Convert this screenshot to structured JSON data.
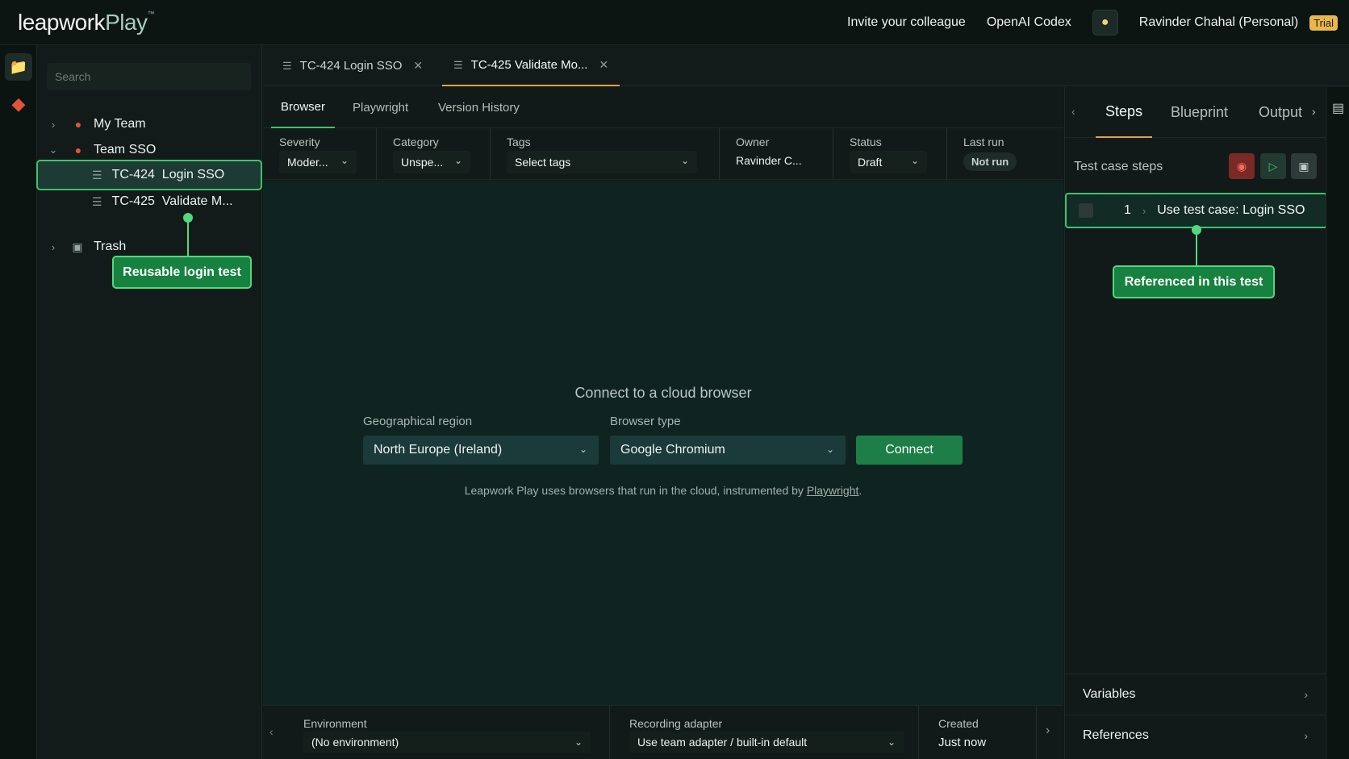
{
  "app": {
    "logo_main": "leapwork",
    "logo_accent": "Play",
    "logo_tm": "™"
  },
  "topbar": {
    "invite": "Invite your colleague",
    "openai": "OpenAI Codex",
    "user": "Ravinder Chahal (Personal)",
    "trial": "Trial"
  },
  "sidebar": {
    "search_placeholder": "Search",
    "items": [
      {
        "label": "My Team"
      },
      {
        "label": "Team SSO"
      },
      {
        "label": "TC-424  Login SSO"
      },
      {
        "label": "TC-425  Validate M..."
      },
      {
        "label": "Trash"
      }
    ]
  },
  "tabs": [
    {
      "label": "TC-424 Login SSO"
    },
    {
      "label": "TC-425 Validate Mo..."
    }
  ],
  "subtabs": [
    "Browser",
    "Playwright",
    "Version History"
  ],
  "meta": {
    "severity_label": "Severity",
    "severity_value": "Moder...",
    "category_label": "Category",
    "category_value": "Unspe...",
    "tags_label": "Tags",
    "tags_value": "Select tags",
    "owner_label": "Owner",
    "owner_value": "Ravinder C...",
    "status_label": "Status",
    "status_value": "Draft",
    "lastrun_label": "Last run",
    "lastrun_value": "Not run"
  },
  "connect": {
    "title": "Connect to a cloud browser",
    "region_label": "Geographical region",
    "region_value": "North Europe (Ireland)",
    "browser_label": "Browser type",
    "browser_value": "Google Chromium",
    "button": "Connect",
    "note_prefix": "Leapwork Play uses browsers that run in the cloud, instrumented by ",
    "note_link": "Playwright",
    "note_suffix": "."
  },
  "bottom": {
    "env_label": "Environment",
    "env_value": "(No environment)",
    "adapter_label": "Recording adapter",
    "adapter_value": "Use team adapter / built-in default",
    "created_label": "Created",
    "created_value": "Just now"
  },
  "right": {
    "tabs": [
      "Steps",
      "Blueprint",
      "Output"
    ],
    "steps_title": "Test case steps",
    "step": {
      "number": "1",
      "label": "Use test case: Login SSO"
    },
    "variables": "Variables",
    "references": "References"
  },
  "callouts": {
    "left": "Reusable login test",
    "right": "Referenced in this test"
  },
  "colors": {
    "accent_green": "#3ec46a",
    "callout_bg": "#17823f",
    "active_tab": "#e0a24a",
    "trial": "#e9b74a"
  }
}
